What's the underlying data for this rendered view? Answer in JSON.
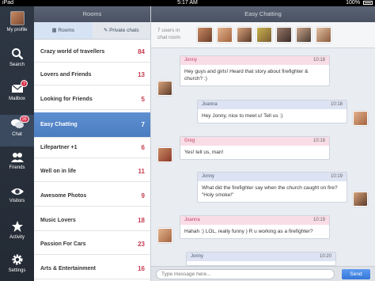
{
  "status_bar": {
    "carrier": "iPad",
    "time": "5:17 AM",
    "battery": "100%"
  },
  "nav": {
    "profile_label": "My profile",
    "items": [
      {
        "label": "Search",
        "icon": "search-icon",
        "badge": ""
      },
      {
        "label": "Mailbox",
        "icon": "mail-icon",
        "badge": "7"
      },
      {
        "label": "Chat",
        "icon": "chat-icon",
        "badge": "99"
      },
      {
        "label": "Friends",
        "icon": "friends-icon",
        "badge": ""
      },
      {
        "label": "Visitors",
        "icon": "eye-icon",
        "badge": ""
      },
      {
        "label": "Activity",
        "icon": "star-icon",
        "badge": ""
      },
      {
        "label": "Settings",
        "icon": "gear-icon",
        "badge": ""
      }
    ]
  },
  "rooms": {
    "title": "Rooms",
    "tabs": [
      "Rooms",
      "Private chats"
    ],
    "list": [
      {
        "name": "Crazy world of travellers",
        "count": "84"
      },
      {
        "name": "Lovers and Friends",
        "count": "13"
      },
      {
        "name": "Looking for Friends",
        "count": "5"
      },
      {
        "name": "Easy Chatting",
        "count": "7"
      },
      {
        "name": "Lifepartner +1",
        "count": "6"
      },
      {
        "name": "Well on in life",
        "count": "11"
      },
      {
        "name": "Awesome Photos",
        "count": "9"
      },
      {
        "name": "Music Lovers",
        "count": "18"
      },
      {
        "name": "Passion For Cars",
        "count": "23"
      },
      {
        "name": "Arts & Entertainment",
        "count": "16"
      }
    ]
  },
  "chat": {
    "title": "Easy Chatting",
    "users_label_line1": "7 users in",
    "users_label_line2": "chat room",
    "messages": [
      {
        "author": "Jonny",
        "time": "10:18",
        "text": "Hey guys and girls! Heard that story about firefighter & church? :)"
      },
      {
        "author": "Joanna",
        "time": "10:18",
        "text": "Hey Jonny, nice to meet u! Tell us :)"
      },
      {
        "author": "Greg",
        "time": "10:18",
        "text": "Yes! tell us, man!"
      },
      {
        "author": "Jonny",
        "time": "10:19",
        "text": "What did the firefighter say when the church caught on fire? \"Holy smoke!\""
      },
      {
        "author": "Joanna",
        "time": "10:19",
        "text": "Hahah :) LOL, really funny ) R u working as a firefighter?"
      },
      {
        "author": "Jonny",
        "time": "10:20",
        "text": ""
      }
    ],
    "input_placeholder": "Type message here...",
    "send_label": "Send"
  },
  "colors": {
    "accent": "#4a7cc1",
    "badge": "#d9324e",
    "count": "#c53a4f",
    "nav_bg": "#2e3744"
  }
}
